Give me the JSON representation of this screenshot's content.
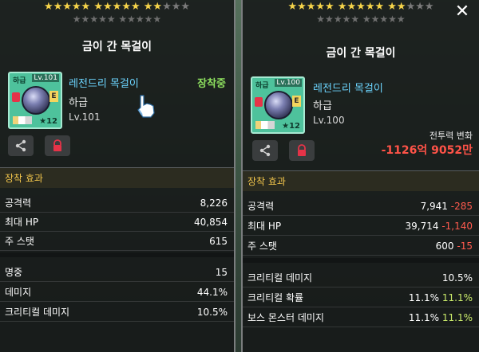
{
  "left": {
    "stars_top": [
      "★★★★★",
      "★★★★★",
      "★★",
      "★★★"
    ],
    "stars_sub": "★★★★★  ★★★★★",
    "title": "금이 간 목걸이",
    "icon": {
      "grade": "하급",
      "level": "Lv.101",
      "e_badge": "E",
      "star_count": "12"
    },
    "item_name": "레전드리 목걸이",
    "item_grade": "하급",
    "item_level": "Lv.101",
    "equipped": "장착중",
    "section_header": "장착 효과",
    "stats": [
      {
        "name": "공격력",
        "value": "8,226"
      },
      {
        "name": "최대 HP",
        "value": "40,854"
      },
      {
        "name": "주 스탯",
        "value": "615"
      }
    ],
    "stats2": [
      {
        "name": "명중",
        "value": "15"
      },
      {
        "name": "데미지",
        "value": "44.1%"
      },
      {
        "name": "크리티컬 데미지",
        "value": "10.5%"
      }
    ]
  },
  "right": {
    "stars_top": [
      "★★★★★",
      "★★★★★",
      "★★",
      "★★★"
    ],
    "stars_sub": "★★★★★  ★★★★★",
    "title": "금이 간 목걸이",
    "close": "✕",
    "icon": {
      "grade": "하급",
      "level": "Lv.100",
      "e_badge": "E",
      "star_count": "12"
    },
    "item_name": "레전드리 목걸이",
    "item_grade": "하급",
    "item_level": "Lv.100",
    "combat_label": "전투력 변화",
    "combat_value": "-1126억 9052만",
    "section_header": "장착 효과",
    "stats": [
      {
        "name": "공격력",
        "value": "7,941",
        "delta": "-285"
      },
      {
        "name": "최대 HP",
        "value": "39,714",
        "delta": "-1,140"
      },
      {
        "name": "주 스탯",
        "value": "600",
        "delta": "-15"
      }
    ],
    "stats2": [
      {
        "name": "크리티컬 데미지",
        "value": "10.5%",
        "delta": ""
      },
      {
        "name": "크리티컬 확률",
        "value": "11.1%",
        "delta": "11.1%"
      },
      {
        "name": "보스 몬스터 데미지",
        "value": "11.1%",
        "delta": "11.1%"
      }
    ]
  },
  "colors": {
    "accent_name": "#6cd5ff",
    "equipped": "#8ee05f",
    "section": "#f0c44b",
    "negative": "#ff5a4e",
    "positive": "#c9ea6a"
  }
}
